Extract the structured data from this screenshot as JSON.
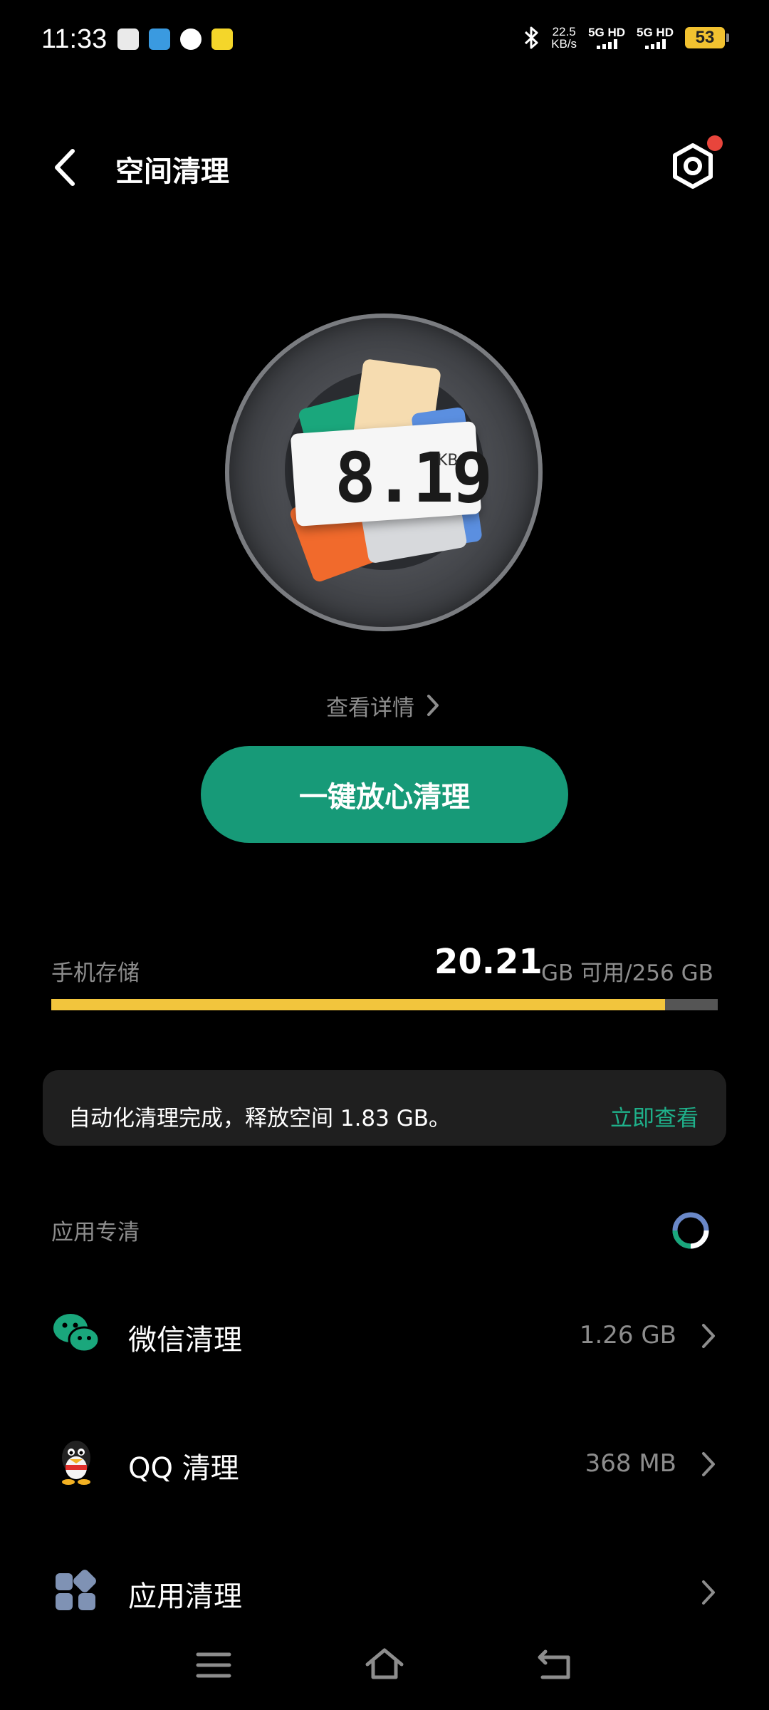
{
  "status_bar": {
    "time": "11:33",
    "net_speed_value": "22.5",
    "net_speed_unit": "KB/s",
    "sim1": "5G HD",
    "sim2": "5G HD",
    "battery": "53",
    "left_icons": [
      "vivo-icon",
      "telegram-icon",
      "chat-bubble-icon",
      "app-icon"
    ]
  },
  "header": {
    "title": "空间清理"
  },
  "hero": {
    "value": "8.19",
    "unit": "KB"
  },
  "details_link": "查看详情",
  "primary_button": "一键放心清理",
  "storage": {
    "label": "手机存储",
    "free_value": "20.21",
    "rest": "GB 可用/256 GB",
    "used_fraction": 0.921
  },
  "notice": {
    "text": "自动化清理完成，释放空间 1.83 GB。",
    "link": "立即查看"
  },
  "section": {
    "title": "应用专清"
  },
  "apps": [
    {
      "label": "微信清理",
      "size": "1.26 GB",
      "icon": "wechat-icon"
    },
    {
      "label": "QQ 清理",
      "size": "368 MB",
      "icon": "qq-icon"
    },
    {
      "label": "应用清理",
      "size": "",
      "icon": "apps-grid-icon"
    }
  ],
  "colors": {
    "accent_green": "#179a78",
    "link_green": "#1fb08a",
    "storage_fill": "#f2c53d",
    "notif_red": "#e8453c"
  }
}
